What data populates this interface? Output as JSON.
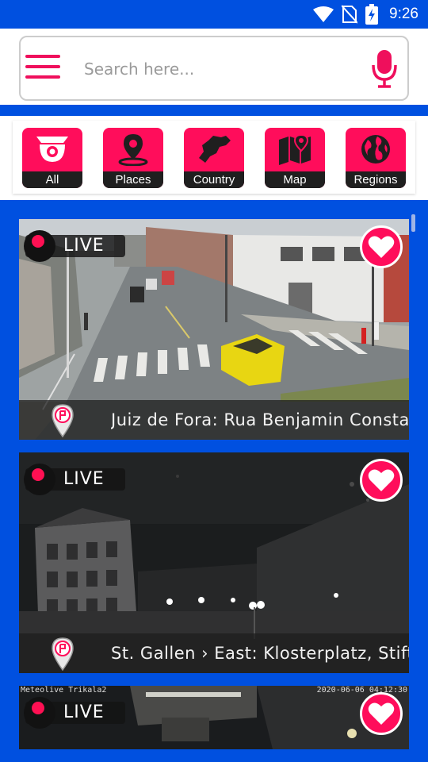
{
  "status_bar": {
    "time": "9:26",
    "icons": [
      "wifi-icon",
      "no-sim-icon",
      "battery-charging-icon"
    ]
  },
  "search": {
    "placeholder": "Search here...",
    "menu_icon": "hamburger-menu-icon",
    "mic_icon": "microphone-icon"
  },
  "categories": [
    {
      "label": "All",
      "icon": "security-camera-icon"
    },
    {
      "label": "Places",
      "icon": "location-pin-icon"
    },
    {
      "label": "Country",
      "icon": "country-map-icon"
    },
    {
      "label": "Map",
      "icon": "folded-map-icon"
    },
    {
      "label": "Regions",
      "icon": "globe-icon"
    }
  ],
  "colors": {
    "primary_blue": "#0050e0",
    "accent_pink": "#ff0d5b",
    "label_dark": "#1f1f1f"
  },
  "cameras": [
    {
      "live_label": "LIVE",
      "title": "Juiz de Fora: Rua Benjamin Constant",
      "scene": "day-street-intersection"
    },
    {
      "live_label": "LIVE",
      "title": "St. Gallen › East: Klosterplatz, Stiftsbezirk",
      "scene": "night-square"
    },
    {
      "live_label": "LIVE",
      "overlay_text_left": "Meteolive Trikala2",
      "overlay_text_right": "2020-06-06 04:12:30",
      "scene": "night-street"
    }
  ]
}
